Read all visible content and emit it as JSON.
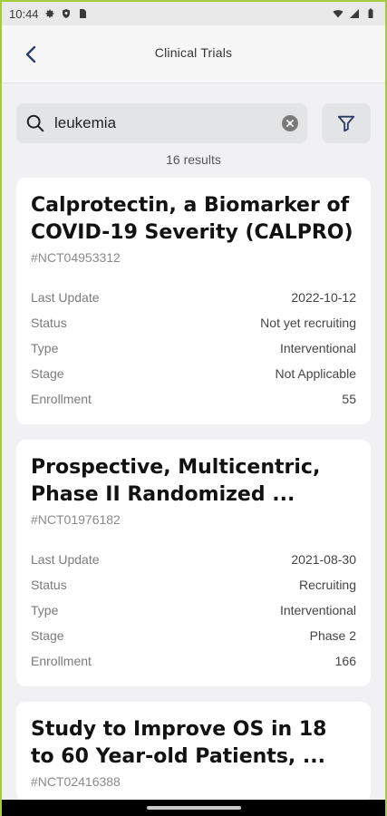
{
  "status_bar": {
    "time": "10:44"
  },
  "app_bar": {
    "title": "Clinical Trials"
  },
  "search": {
    "value": "leukemia"
  },
  "results_count": "16 results",
  "trials": [
    {
      "title": "Calprotectin, a Biomarker of COVID-19 Severity (CALPRO)",
      "id": "#NCT04953312",
      "fields": [
        {
          "label": "Last Update",
          "value": "2022-10-12"
        },
        {
          "label": "Status",
          "value": "Not yet recruiting"
        },
        {
          "label": "Type",
          "value": "Interventional"
        },
        {
          "label": "Stage",
          "value": "Not Applicable"
        },
        {
          "label": "Enrollment",
          "value": "55"
        }
      ]
    },
    {
      "title": "Prospective, Multicentric, Phase II Randomized ...",
      "id": "#NCT01976182",
      "fields": [
        {
          "label": "Last Update",
          "value": "2021-08-30"
        },
        {
          "label": "Status",
          "value": "Recruiting"
        },
        {
          "label": "Type",
          "value": "Interventional"
        },
        {
          "label": "Stage",
          "value": "Phase 2"
        },
        {
          "label": "Enrollment",
          "value": "166"
        }
      ]
    },
    {
      "title": "Study to Improve OS in 18 to 60 Year-old Patients, ...",
      "id": "#NCT02416388"
    }
  ]
}
